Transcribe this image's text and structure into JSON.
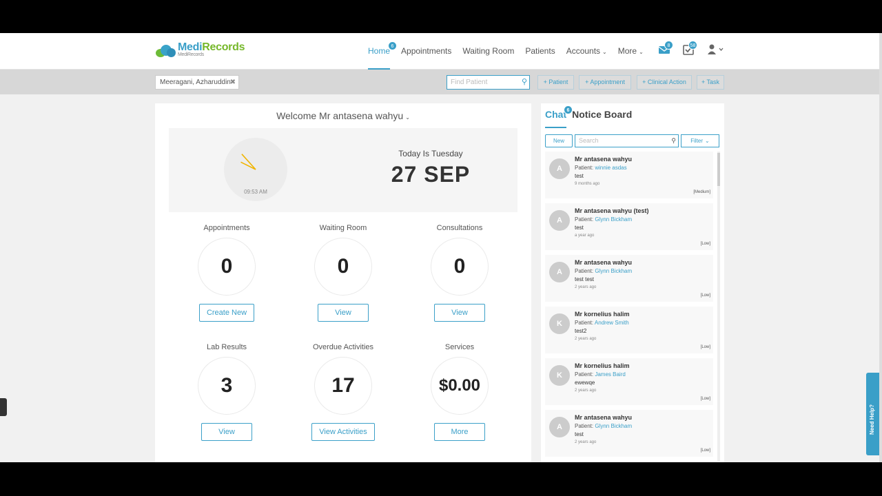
{
  "brand": {
    "name_a": "Medi",
    "name_b": "Records",
    "sub": "MediRecords"
  },
  "nav": {
    "items": [
      "Home",
      "Appointments",
      "Waiting Room",
      "Patients",
      "Accounts",
      "More"
    ],
    "home_badge": "6",
    "mail_badge": "8",
    "tasks_badge": "58"
  },
  "toolbar": {
    "patient_chip": "Meeragani, Azharuddin",
    "find_placeholder": "Find Patient",
    "buttons": [
      "+ Patient",
      "+ Appointment",
      "+ Clinical Action",
      "+ Task"
    ]
  },
  "welcome": "Welcome Mr antasena wahyu",
  "clock": {
    "time": "09:53 AM",
    "hour_hand_value": 9.88,
    "minute_hand_value": 53
  },
  "today": {
    "label": "Today Is Tuesday",
    "date": "27 SEP"
  },
  "stats": [
    {
      "label": "Appointments",
      "value": "0",
      "button": "Create New"
    },
    {
      "label": "Waiting Room",
      "value": "0",
      "button": "View"
    },
    {
      "label": "Consultations",
      "value": "0",
      "button": "View"
    },
    {
      "label": "Lab Results",
      "value": "3",
      "button": "View"
    },
    {
      "label": "Overdue Activities",
      "value": "17",
      "button": "View Activities"
    },
    {
      "label": "Services",
      "value": "$0.00",
      "button": "More"
    }
  ],
  "chat": {
    "tab_chat": "Chat",
    "tab_badge": "6",
    "tab_notice": "Notice Board",
    "new_label": "New",
    "search_placeholder": "Search",
    "filter_label": "Filter",
    "messages": [
      {
        "initial": "A",
        "name": "Mr antasena wahyu",
        "patient_prefix": "Patient: ",
        "patient": "winnie asdas",
        "body": "test",
        "ago": "9 months ago",
        "priority": "[Medium]"
      },
      {
        "initial": "A",
        "name": "Mr antasena wahyu (test)",
        "patient_prefix": "Patient: ",
        "patient": "Glynn Bickham",
        "body": "test",
        "ago": "a year ago",
        "priority": "[Low]"
      },
      {
        "initial": "A",
        "name": "Mr antasena wahyu",
        "patient_prefix": "Patient: ",
        "patient": "Glynn Bickham",
        "body": "test test",
        "ago": "2 years ago",
        "priority": "[Low]"
      },
      {
        "initial": "K",
        "name": "Mr kornelius halim",
        "patient_prefix": "Patient: ",
        "patient": "Andrew Smith",
        "body": "test2",
        "ago": "2 years ago",
        "priority": "[Low]"
      },
      {
        "initial": "K",
        "name": "Mr kornelius halim",
        "patient_prefix": "Patient: ",
        "patient": "James Baird",
        "body": "ewewqe",
        "ago": "2 years ago",
        "priority": "[Low]"
      },
      {
        "initial": "A",
        "name": "Mr antasena wahyu",
        "patient_prefix": "Patient: ",
        "patient": "Glynn Bickham",
        "body": "test",
        "ago": "2 years ago",
        "priority": "[Low]"
      }
    ]
  },
  "help_tab": "Need Help?",
  "colors": {
    "accent": "#3a9fc8",
    "brand_green": "#76b82a",
    "clock_hand": "#f0b400"
  }
}
